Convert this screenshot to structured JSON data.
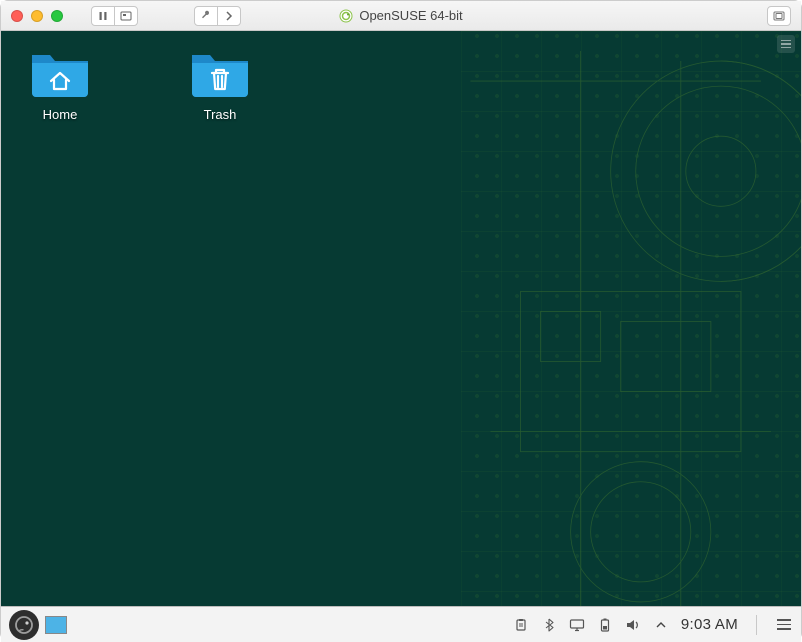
{
  "host_titlebar": {
    "title": "OpenSUSE 64-bit",
    "btn_pause_tip": "Pause",
    "btn_snapshot_tip": "Snapshot",
    "btn_settings_tip": "Settings",
    "btn_next_tip": "Next",
    "btn_fullscreen_tip": "Fullscreen"
  },
  "desktop": {
    "icons": [
      {
        "name": "home",
        "label": "Home"
      },
      {
        "name": "trash",
        "label": "Trash"
      }
    ]
  },
  "taskbar": {
    "start_tip": "Application Menu",
    "pager_tip": "Workspace 1",
    "tray": {
      "clipboard_tip": "Clipboard",
      "bluetooth_tip": "Bluetooth",
      "display_tip": "Display",
      "battery_tip": "Battery",
      "volume_tip": "Volume",
      "expand_tip": "Show hidden icons",
      "time": "9:03 AM",
      "menu_tip": "Menu"
    }
  }
}
